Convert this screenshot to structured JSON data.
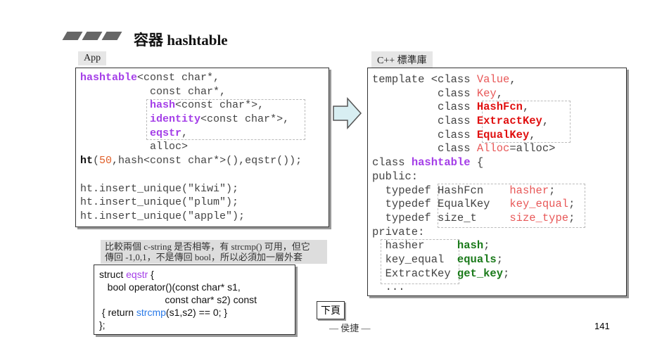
{
  "title": "容器 hashtable",
  "app_tag": "App",
  "lib_tag": "C++ 標準庫",
  "app_code": [
    [
      [
        "hashtable",
        "p"
      ],
      [
        "<const char*,",
        ""
      ]
    ],
    [
      [
        "           const char*,",
        ""
      ]
    ],
    [
      [
        "           ",
        ""
      ],
      [
        "hash",
        "p"
      ],
      [
        "<const char*>,",
        ""
      ]
    ],
    [
      [
        "           ",
        ""
      ],
      [
        "identity",
        "p"
      ],
      [
        "<const char*>,",
        ""
      ]
    ],
    [
      [
        "           ",
        ""
      ],
      [
        "eqstr",
        "p"
      ],
      [
        ",",
        ""
      ]
    ],
    [
      [
        "           alloc>",
        ""
      ]
    ],
    [
      [
        "ht",
        "b"
      ],
      [
        "(",
        ""
      ],
      [
        "50",
        "o"
      ],
      [
        ",hash<const char*>(),eqstr());",
        ""
      ]
    ],
    [
      [
        "",
        ""
      ]
    ],
    [
      [
        "ht.insert_unique(\"kiwi\");",
        ""
      ]
    ],
    [
      [
        "ht.insert_unique(\"plum\");",
        ""
      ]
    ],
    [
      [
        "ht.insert_unique(\"apple\");",
        ""
      ]
    ]
  ],
  "lib_code": [
    [
      [
        "template <class ",
        ""
      ],
      [
        "Value",
        "rl"
      ],
      [
        ",",
        ""
      ]
    ],
    [
      [
        "          class ",
        ""
      ],
      [
        "Key",
        "rl"
      ],
      [
        ",",
        ""
      ]
    ],
    [
      [
        "          class ",
        ""
      ],
      [
        "HashFcn",
        "r"
      ],
      [
        ",",
        ""
      ]
    ],
    [
      [
        "          class ",
        ""
      ],
      [
        "ExtractKey",
        "r"
      ],
      [
        ",",
        ""
      ]
    ],
    [
      [
        "          class ",
        ""
      ],
      [
        "EqualKey",
        "r"
      ],
      [
        ",",
        ""
      ]
    ],
    [
      [
        "          class ",
        ""
      ],
      [
        "Alloc",
        "rl"
      ],
      [
        "=alloc>",
        ""
      ]
    ],
    [
      [
        "class ",
        ""
      ],
      [
        "hashtable",
        "p"
      ],
      [
        " {",
        ""
      ]
    ],
    [
      [
        "public:",
        ""
      ]
    ],
    [
      [
        "  typedef HashFcn    ",
        ""
      ],
      [
        "hasher",
        "rl"
      ],
      [
        ";",
        ""
      ]
    ],
    [
      [
        "  typedef EqualKey   ",
        ""
      ],
      [
        "key_equal",
        "rl"
      ],
      [
        ";",
        ""
      ]
    ],
    [
      [
        "  typedef size_t     ",
        ""
      ],
      [
        "size_type",
        "rl"
      ],
      [
        ";",
        ""
      ]
    ],
    [
      [
        "private:",
        ""
      ]
    ],
    [
      [
        "  hasher     ",
        ""
      ],
      [
        "hash",
        "g"
      ],
      [
        ";",
        ""
      ]
    ],
    [
      [
        "  key_equal  ",
        ""
      ],
      [
        "equals",
        "g"
      ],
      [
        ";",
        ""
      ]
    ],
    [
      [
        "  ExtractKey ",
        ""
      ],
      [
        "get_key",
        "g"
      ],
      [
        ";",
        ""
      ]
    ],
    [
      [
        "  ...",
        ""
      ]
    ]
  ],
  "note": [
    "比較兩個 c-string 是否相等，有 strcmp() 可用，但它",
    "傳回 -1,0,1，不是傳回 bool，所以必須加一層外套"
  ],
  "struct_code": [
    [
      [
        "struct ",
        ""
      ],
      [
        "eqstr",
        "sp"
      ],
      [
        " {",
        ""
      ]
    ],
    [
      [
        "   bool operator()(const char* s1,",
        ""
      ]
    ],
    [
      [
        "                        const char* s2) const",
        ""
      ]
    ],
    [
      [
        " { return ",
        ""
      ],
      [
        "strcmp",
        "sb"
      ],
      [
        "(s1,s2) == 0; }",
        ""
      ]
    ],
    [
      [
        "};",
        ""
      ]
    ]
  ],
  "next_button": "下頁",
  "footer": "— 侯捷 —",
  "page_number": "141"
}
